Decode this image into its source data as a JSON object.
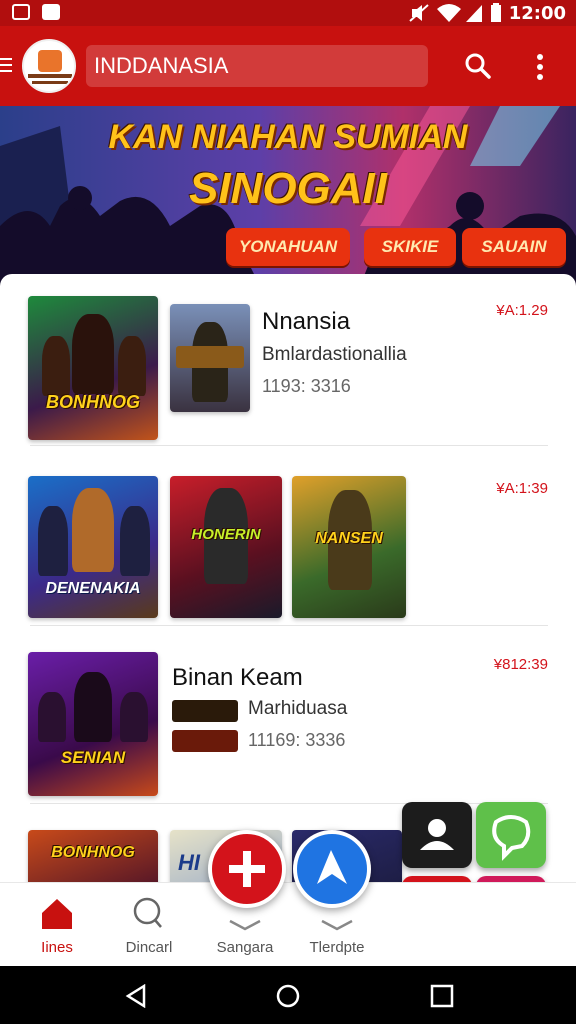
{
  "status_bar": {
    "time": "12:00",
    "icons": [
      "mute-icon",
      "wifi-icon",
      "signal-icon",
      "battery-icon"
    ]
  },
  "app_bar": {
    "title": "INDDANASIA"
  },
  "banner": {
    "line1": "KAN NIAHAN SUMIAN",
    "line2": "SINOGAII",
    "chips": [
      "YONAHUAN",
      "SKIKIE",
      "SAUAIN"
    ]
  },
  "rows": [
    {
      "title": "Nnansia",
      "subtitle": "Bmlardastionallia",
      "meta": "1193: 3316",
      "price": "¥A:1.29",
      "thumbs": [
        "BONHNOG",
        ""
      ]
    },
    {
      "price": "¥A:1:39",
      "thumbs": [
        "DENENAKIA",
        "HONERIN",
        "NANSEN"
      ]
    },
    {
      "title": "Binan Keam",
      "subtitle": "Marhiduasa",
      "meta": "11169: 3336",
      "price": "¥812:39",
      "thumbs": [
        "SENIAN"
      ]
    },
    {
      "thumbs": [
        "BONHNOG",
        "HI",
        ""
      ]
    }
  ],
  "bottom_nav": {
    "items": [
      {
        "label": "Iines",
        "icon": "home-icon"
      },
      {
        "label": "Dincarl",
        "icon": "search-icon"
      },
      {
        "label": "Sangara",
        "icon": "chevron-icon"
      },
      {
        "label": "Tlerdpte",
        "icon": "chevron-icon"
      }
    ]
  },
  "colors": {
    "primary": "#c8110f",
    "accent": "#d3131b",
    "price": "#d3131b",
    "blue": "#1f74e2"
  }
}
